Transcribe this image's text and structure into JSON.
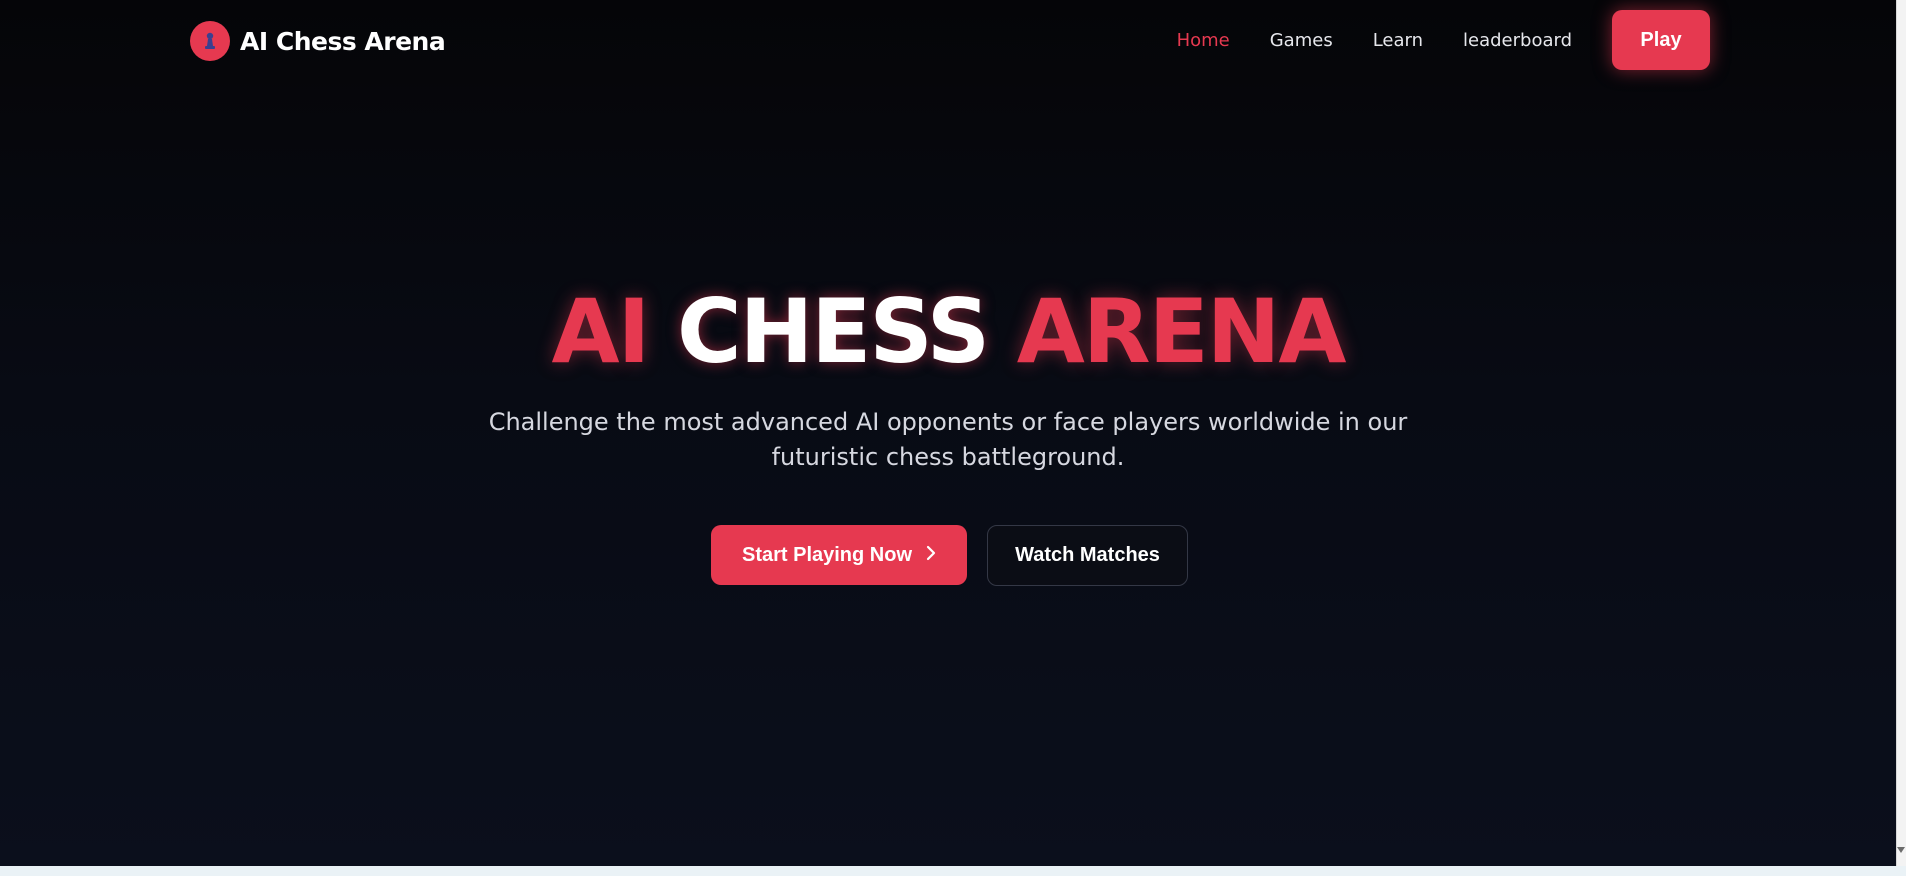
{
  "nav": {
    "brand_name": "AI Chess Arena",
    "links": [
      {
        "label": "Home",
        "active": true
      },
      {
        "label": "Games",
        "active": false
      },
      {
        "label": "Learn",
        "active": false
      },
      {
        "label": "leaderboard",
        "active": false
      }
    ],
    "play_label": "Play"
  },
  "hero": {
    "title_part1": "AI",
    "title_part2": "CHESS",
    "title_part3": "ARENA",
    "subtitle": "Challenge the most advanced AI opponents or face players worldwide in our futuristic chess battleground.",
    "primary_label": "Start Playing Now",
    "secondary_label": "Watch Matches"
  },
  "colors": {
    "accent": "#e63950",
    "background": "#06070b",
    "text": "#ffffff"
  },
  "icons": {
    "brand": "chess-pawn-icon",
    "primary_button": "chevron-right-icon"
  }
}
